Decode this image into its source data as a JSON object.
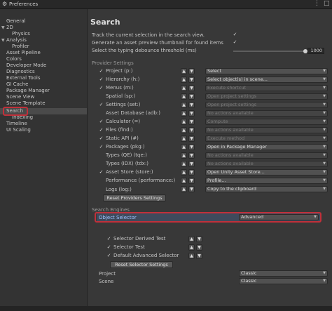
{
  "window": {
    "title": "Preferences"
  },
  "sidebar": {
    "items": [
      {
        "label": "General"
      },
      {
        "label": "2D"
      },
      {
        "label": "Physics"
      },
      {
        "label": "Analysis"
      },
      {
        "label": "Profiler"
      },
      {
        "label": "Asset Pipeline"
      },
      {
        "label": "Colors"
      },
      {
        "label": "Developer Mode"
      },
      {
        "label": "Diagnostics"
      },
      {
        "label": "External Tools"
      },
      {
        "label": "GI Cache"
      },
      {
        "label": "Package Manager"
      },
      {
        "label": "Scene View"
      },
      {
        "label": "Scene Template"
      },
      {
        "label": "Search"
      },
      {
        "label": "Indexing"
      },
      {
        "label": "Timeline"
      },
      {
        "label": "UI Scaling"
      }
    ]
  },
  "main": {
    "title": "Search",
    "general": [
      {
        "label": "Track the current selection in the search view.",
        "checked": true
      },
      {
        "label": "Generate an asset preview thumbnail for found items",
        "checked": true
      },
      {
        "label": "Select the typing debounce threshold (ms)",
        "value": "1000"
      }
    ],
    "provider_section": "Provider Settings",
    "providers": [
      {
        "label": "Project (p:)",
        "checked": true,
        "action": "Select",
        "enabled": true
      },
      {
        "label": "Hierarchy (h:)",
        "checked": true,
        "action": "Select object(s) in scene...",
        "enabled": true
      },
      {
        "label": "Menus (m:)",
        "checked": true,
        "action": "Execute shortcut",
        "enabled": false
      },
      {
        "label": "Spatial (sp:)",
        "checked": false,
        "action": "Open project settings",
        "enabled": false
      },
      {
        "label": "Settings (set:)",
        "checked": true,
        "action": "Open project settings",
        "enabled": false
      },
      {
        "label": "Asset Database (adb:)",
        "checked": false,
        "action": "No actions available",
        "enabled": false
      },
      {
        "label": "Calculator (=)",
        "checked": true,
        "action": "Compute",
        "enabled": false
      },
      {
        "label": "Files (find:)",
        "checked": true,
        "action": "No actions available",
        "enabled": false
      },
      {
        "label": "Static API (#)",
        "checked": true,
        "action": "Execute method",
        "enabled": false
      },
      {
        "label": "Packages (pkg:)",
        "checked": true,
        "action": "Open in Package Manager",
        "enabled": true
      },
      {
        "label": "Types (QE) (tqe:)",
        "checked": false,
        "action": "No actions available",
        "enabled": false
      },
      {
        "label": "Types (IDX) (tdx:)",
        "checked": false,
        "action": "No actions available",
        "enabled": false
      },
      {
        "label": "Asset Store (store:)",
        "checked": true,
        "action": "Open Unity Asset Store...",
        "enabled": true
      },
      {
        "label": "Performance (performance:)",
        "checked": false,
        "action": "Profile...",
        "enabled": true
      },
      {
        "label": "Logs (log:)",
        "checked": false,
        "action": "Copy to the clipboard",
        "enabled": true
      }
    ],
    "reset_providers_label": "Reset Providers Settings",
    "engines_section": "Search Engines",
    "object_selector": {
      "label": "Object Selector",
      "value": "Advanced"
    },
    "selectors": [
      {
        "label": "Selector Derived Test",
        "checked": true
      },
      {
        "label": "Selector Test",
        "checked": true
      },
      {
        "label": "Default Advanced Selector",
        "checked": true
      }
    ],
    "reset_selector_label": "Reset Selector Settings",
    "project": {
      "label": "Project",
      "value": "Classic"
    },
    "scene": {
      "label": "Scene",
      "value": "Classic"
    }
  },
  "glyphs": {
    "check": "✓",
    "up": "▲",
    "down": "▼",
    "caret": "▼",
    "expanded": "▼",
    "gear": "⚙",
    "menu": "⋮",
    "close": "□"
  },
  "colors": {
    "background": "#383838",
    "highlight": "#c0303a",
    "selected_row": "#3e4a5c"
  }
}
